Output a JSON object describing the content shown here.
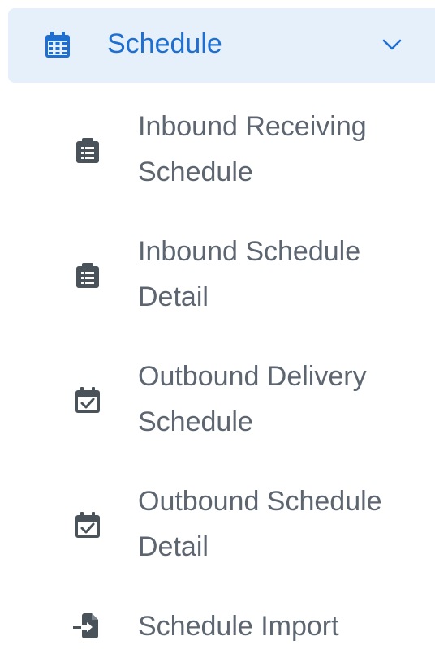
{
  "nav": {
    "section": {
      "label": "Schedule",
      "icon": "calendar-icon",
      "expanded": true,
      "accent_color": "#1f6fd1",
      "background_color": "#e6f0fb"
    },
    "items": [
      {
        "label": "Inbound Receiving Schedule",
        "icon": "clipboard-list-icon"
      },
      {
        "label": "Inbound Schedule Detail",
        "icon": "clipboard-list-icon"
      },
      {
        "label": "Outbound Delivery Schedule",
        "icon": "calendar-check-icon"
      },
      {
        "label": "Outbound Schedule Detail",
        "icon": "calendar-check-icon"
      },
      {
        "label": "Schedule Import",
        "icon": "file-import-icon"
      }
    ],
    "item_text_color": "#5d6670",
    "item_icon_color": "#4a525a"
  }
}
